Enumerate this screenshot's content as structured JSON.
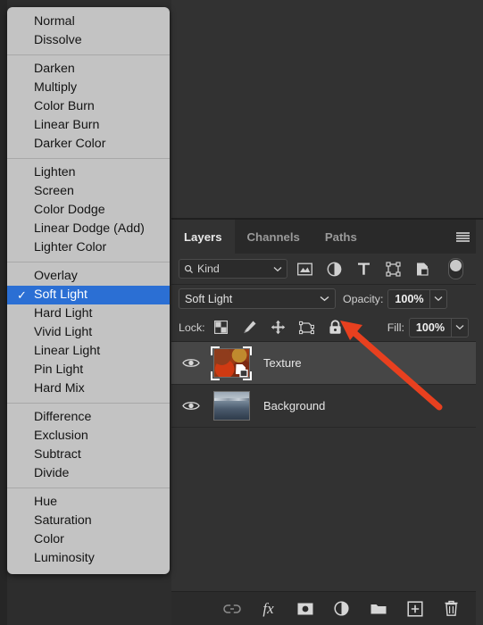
{
  "blend_menu": {
    "name": "blend-mode-menu",
    "selected": "Soft Light",
    "check_glyph": "✓",
    "groups": [
      {
        "items": [
          "Normal",
          "Dissolve"
        ]
      },
      {
        "items": [
          "Darken",
          "Multiply",
          "Color Burn",
          "Linear Burn",
          "Darker Color"
        ]
      },
      {
        "items": [
          "Lighten",
          "Screen",
          "Color Dodge",
          "Linear Dodge (Add)",
          "Lighter Color"
        ]
      },
      {
        "items": [
          "Overlay",
          "Soft Light",
          "Hard Light",
          "Vivid Light",
          "Linear Light",
          "Pin Light",
          "Hard Mix"
        ]
      },
      {
        "items": [
          "Difference",
          "Exclusion",
          "Subtract",
          "Divide"
        ]
      },
      {
        "items": [
          "Hue",
          "Saturation",
          "Color",
          "Luminosity"
        ]
      }
    ]
  },
  "panel": {
    "tabs": [
      {
        "label": "Layers",
        "active": true
      },
      {
        "label": "Channels",
        "active": false
      },
      {
        "label": "Paths",
        "active": false
      }
    ],
    "menu_icon": "hamburger-icon",
    "filter": {
      "kind_label": "Kind",
      "search_icon": "search-icon",
      "chevron": "⌄",
      "icons": [
        "pixel-layer-filter-icon",
        "adjustment-layer-filter-icon",
        "type-layer-filter-icon",
        "shape-layer-filter-icon",
        "smart-object-filter-icon",
        "filter-toggle-switch"
      ]
    },
    "blend": {
      "mode": "Soft Light",
      "chevron": "⌄",
      "opacity_label": "Opacity:",
      "opacity_value": "100%"
    },
    "lock": {
      "label": "Lock:",
      "icons": [
        "lock-transparent-pixels-icon",
        "lock-image-pixels-icon",
        "lock-position-icon",
        "lock-artboard-nesting-icon",
        "lock-all-icon"
      ],
      "fill_label": "Fill:",
      "fill_value": "100%"
    },
    "layers": [
      {
        "name": "Texture",
        "visible": true,
        "selected": true,
        "thumb": "texture",
        "smart_object": true
      },
      {
        "name": "Background",
        "visible": true,
        "selected": false,
        "thumb": "background",
        "smart_object": false
      }
    ],
    "bottom_icons": [
      "link-layers-icon",
      "layer-style-fx-icon",
      "add-layer-mask-icon",
      "new-adjustment-layer-icon",
      "new-group-icon",
      "new-layer-icon",
      "delete-layer-icon"
    ],
    "fx_label": "fx"
  },
  "annotation": {
    "name": "red-arrow-pointer",
    "color": "#e8401f",
    "points_to": "blend-mode-dropdown-chevron"
  }
}
